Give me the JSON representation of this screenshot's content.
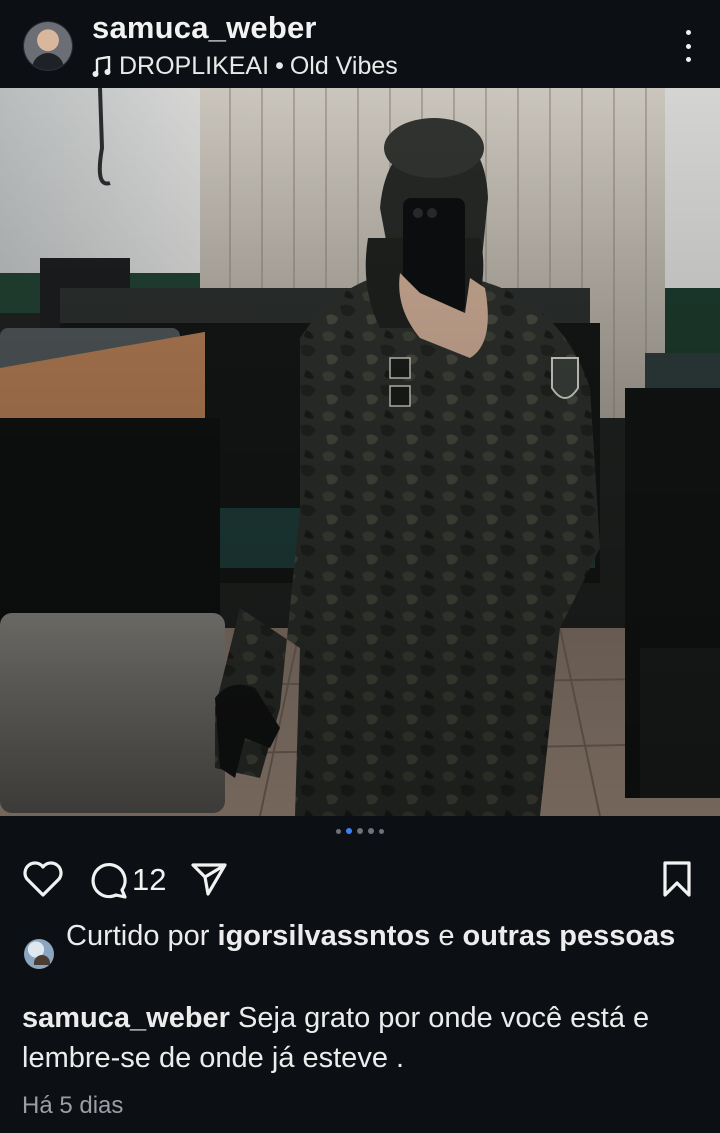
{
  "header": {
    "username": "samuca_weber",
    "music_artist": "DROPLIKEAI",
    "music_separator": "•",
    "music_track": "Old Vibes"
  },
  "carousel": {
    "total": 5,
    "active_index": 1
  },
  "actions": {
    "comment_count": "12"
  },
  "likes": {
    "prefix": "Curtido por",
    "user": "igorsilvassntos",
    "conjunction": "e",
    "others": "outras pessoas"
  },
  "caption": {
    "user": "samuca_weber",
    "text": "Seja grato por onde você está e lembre-se de onde já esteve ."
  },
  "timestamp": "Há 5 dias",
  "icons": [
    "music-note-icon",
    "more-options-icon",
    "heart-icon",
    "comment-icon",
    "share-icon",
    "bookmark-icon"
  ],
  "colors": {
    "background": "#0c0f14",
    "active_dot": "#3b82f6",
    "muted_text": "#9b9ea3"
  }
}
